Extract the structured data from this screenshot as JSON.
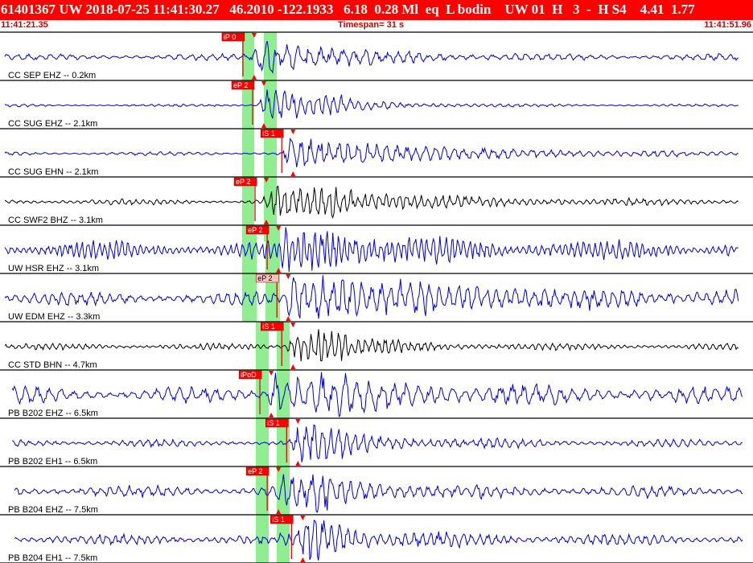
{
  "header": {
    "text": "61401367 UW 2018-07-25 11:41:30.27   46.2010 -122.1933   6.18  0.28 Ml  eq  L bodin    UW 01  H   3  -  H S4    4.41  1.77"
  },
  "timebar": {
    "start": "11:41:21.35",
    "span": "Timespan=  31 s",
    "end": "11:41:51.96"
  },
  "colors": {
    "header_bg": "#ff0000",
    "trace_blue": "#0000cc",
    "trace_black": "#000000",
    "pick_bg": "#ff0000",
    "pick_alt_bg": "#ffc0c0",
    "window_green": "#90ee90"
  },
  "chart_data": {
    "type": "line",
    "title": "61401367 UW 2018-07-25 11:41:30.27",
    "x_start": "11:41:21.35",
    "x_end": "11:41:51.96",
    "timespan_s": 31,
    "channels": [
      {
        "label": "CC SEP EHZ -- 0.2km",
        "color": "blue",
        "picks": [
          {
            "text": "iP 0",
            "t": 10.0,
            "style": "red"
          }
        ],
        "onset": 10.3,
        "end_t": 30.4,
        "noise": 0.1,
        "peak": 0.9,
        "decay": 3.5,
        "period": 0.45
      },
      {
        "label": "CC SUG EHZ -- 2.1km",
        "color": "blue",
        "picks": [
          {
            "text": "eP 2",
            "t": 10.4,
            "style": "red"
          }
        ],
        "onset": 10.6,
        "end_t": 30.4,
        "noise": 0.04,
        "peak": 0.95,
        "decay": 2.5,
        "period": 0.35,
        "burst": 13.0
      },
      {
        "label": "CC SUG EHN -- 2.1km",
        "color": "blue",
        "picks": [
          {
            "text": "iS 1",
            "t": 11.6,
            "style": "red"
          }
        ],
        "onset": 11.6,
        "end_t": 30.4,
        "noise": 0.06,
        "peak": 0.7,
        "decay": 6.0,
        "period": 0.4
      },
      {
        "label": "CC SWF2 BHZ -- 3.1km",
        "color": "black",
        "picks": [
          {
            "text": "eP 2",
            "t": 10.5,
            "style": "red"
          }
        ],
        "onset": 10.8,
        "end_t": 30.4,
        "noise": 0.09,
        "peak": 0.75,
        "decay": 5.0,
        "period": 0.3,
        "burst": 13.0
      },
      {
        "label": "UW HSR EHZ -- 3.1km",
        "color": "blue",
        "picks": [
          {
            "text": "eP 2",
            "t": 11.0,
            "style": "red"
          }
        ],
        "onset": 11.4,
        "end_t": 30.4,
        "noise": 0.28,
        "peak": 0.95,
        "decay": 4.0,
        "period": 0.25
      },
      {
        "label": "UW EDM EHZ -- 3.3km",
        "color": "blue",
        "picks": [
          {
            "text": "eP 2",
            "t": 11.4,
            "style": "pink"
          }
        ],
        "onset": 11.7,
        "end_t": 30.4,
        "noise": 0.22,
        "peak": 0.9,
        "decay": 8.0,
        "period": 0.4,
        "burst": 13.0
      },
      {
        "label": "CC STD BHN -- 4.7km",
        "color": "black",
        "picks": [
          {
            "text": "iS 1",
            "t": 11.6,
            "style": "red"
          }
        ],
        "onset": 11.8,
        "end_t": 30.4,
        "noise": 0.1,
        "peak": 0.9,
        "decay": 2.5,
        "period": 0.28,
        "burst": 12.8
      },
      {
        "label": "PB B202 EHZ -- 6.5km",
        "color": "blue",
        "picks": [
          {
            "text": "iPoD",
            "t": 10.7,
            "style": "red"
          }
        ],
        "onset": 11.0,
        "end_t": 30.6,
        "noise": 0.25,
        "peak": 0.85,
        "decay": 5.0,
        "period": 0.5,
        "start_t": 0.5,
        "burst": 12.8
      },
      {
        "label": "PB B202 EH1 -- 6.5km",
        "color": "blue",
        "picks": [
          {
            "text": "iS 1",
            "t": 11.8,
            "style": "red"
          }
        ],
        "onset": 11.9,
        "end_t": 30.6,
        "noise": 0.12,
        "peak": 0.75,
        "decay": 3.0,
        "period": 0.35,
        "start_t": 0.5,
        "burst": 12.6
      },
      {
        "label": "PB B204 EHZ -- 7.5km",
        "color": "blue",
        "picks": [
          {
            "text": "eP 2",
            "t": 11.0,
            "style": "red"
          }
        ],
        "onset": 11.3,
        "end_t": 30.6,
        "noise": 0.18,
        "peak": 0.85,
        "decay": 3.0,
        "period": 0.4,
        "start_t": 0.6,
        "burst": 12.6
      },
      {
        "label": "PB B204 EH1 -- 7.5km",
        "color": "blue",
        "picks": [
          {
            "text": "iS 1",
            "t": 12.0,
            "style": "red"
          }
        ],
        "onset": 12.2,
        "end_t": 30.6,
        "noise": 0.18,
        "peak": 0.9,
        "decay": 2.5,
        "period": 0.35,
        "start_t": 0.6,
        "burst": 12.7
      }
    ]
  }
}
